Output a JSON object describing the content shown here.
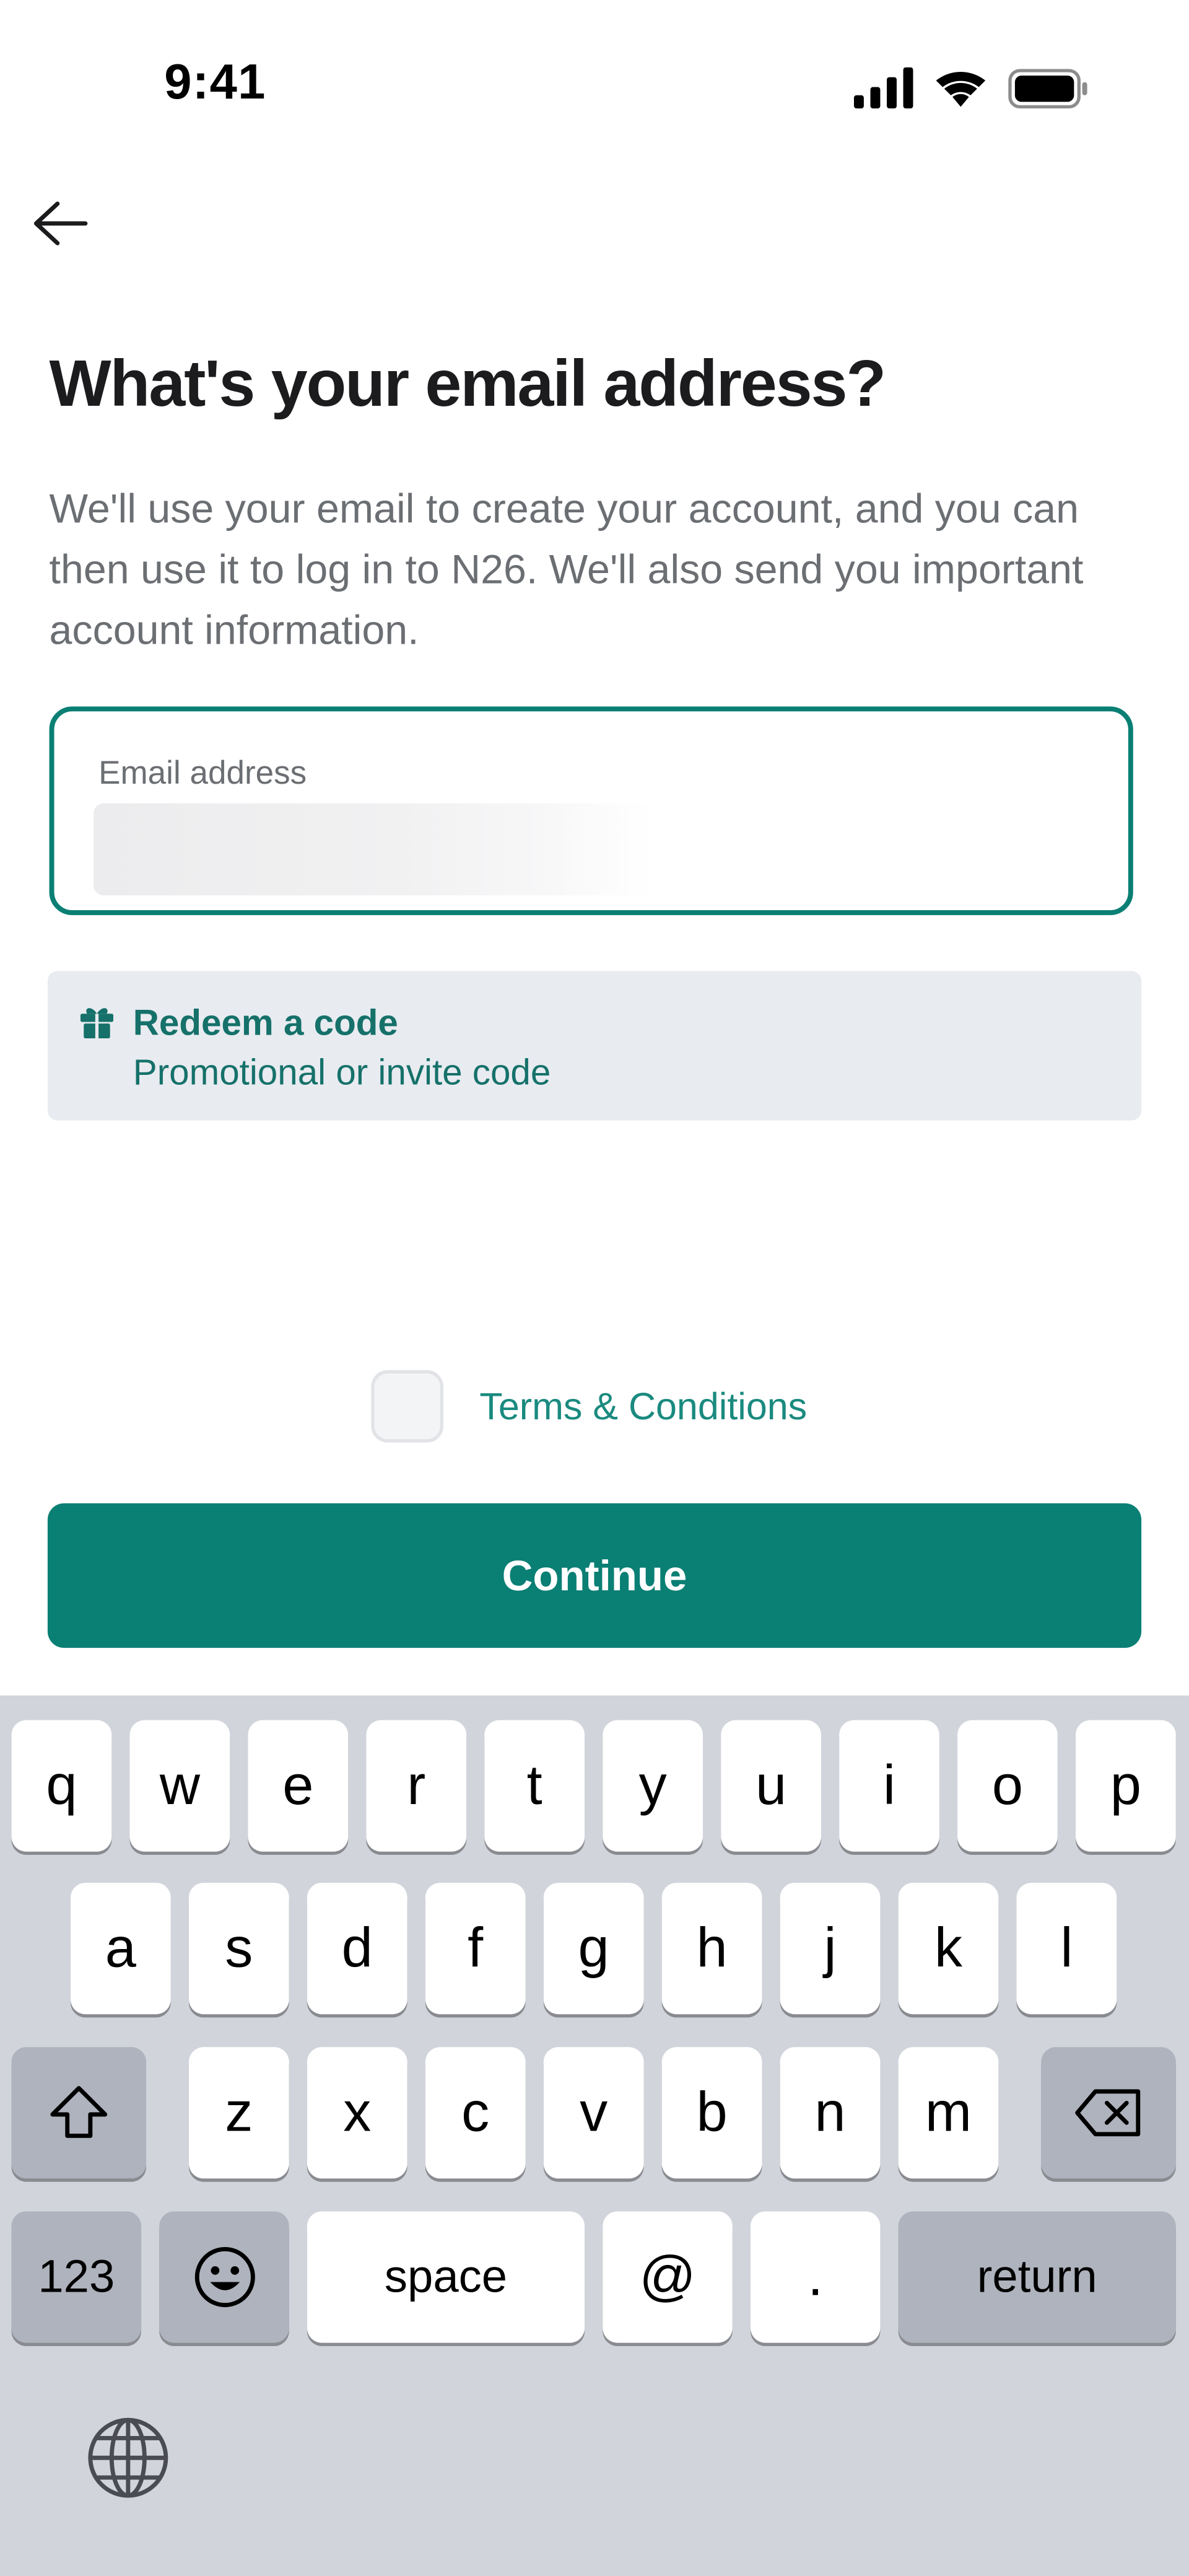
{
  "status_bar": {
    "time": "9:41"
  },
  "header": {
    "back_icon": "arrow-left-icon"
  },
  "main": {
    "title": "What's your email address?",
    "description": "We'll use your email to create your account, and you can then use it to log in to N26. We'll also send you important account information.",
    "email_field": {
      "label": "Email address",
      "value": "",
      "placeholder": ""
    },
    "redeem": {
      "icon": "gift-icon",
      "title": "Redeem a code",
      "subtitle": "Promotional or invite code"
    },
    "terms": {
      "label": "Terms & Conditions",
      "checked": false
    },
    "continue_label": "Continue"
  },
  "colors": {
    "accent": "#0a7f74",
    "link": "#1a8a7f",
    "redeem_bg": "#e8ebf0",
    "keyboard_bg": "#d1d4db"
  },
  "keyboard": {
    "row1": [
      "q",
      "w",
      "e",
      "r",
      "t",
      "y",
      "u",
      "i",
      "o",
      "p"
    ],
    "row2": [
      "a",
      "s",
      "d",
      "f",
      "g",
      "h",
      "j",
      "k",
      "l"
    ],
    "row3": [
      "z",
      "x",
      "c",
      "v",
      "b",
      "n",
      "m"
    ],
    "row4": {
      "numbers": "123",
      "space": "space",
      "at": "@",
      "period": ".",
      "return": "return"
    },
    "icons": {
      "shift": "shift-icon",
      "backspace": "backspace-icon",
      "emoji": "emoji-icon",
      "globe": "globe-icon"
    }
  }
}
